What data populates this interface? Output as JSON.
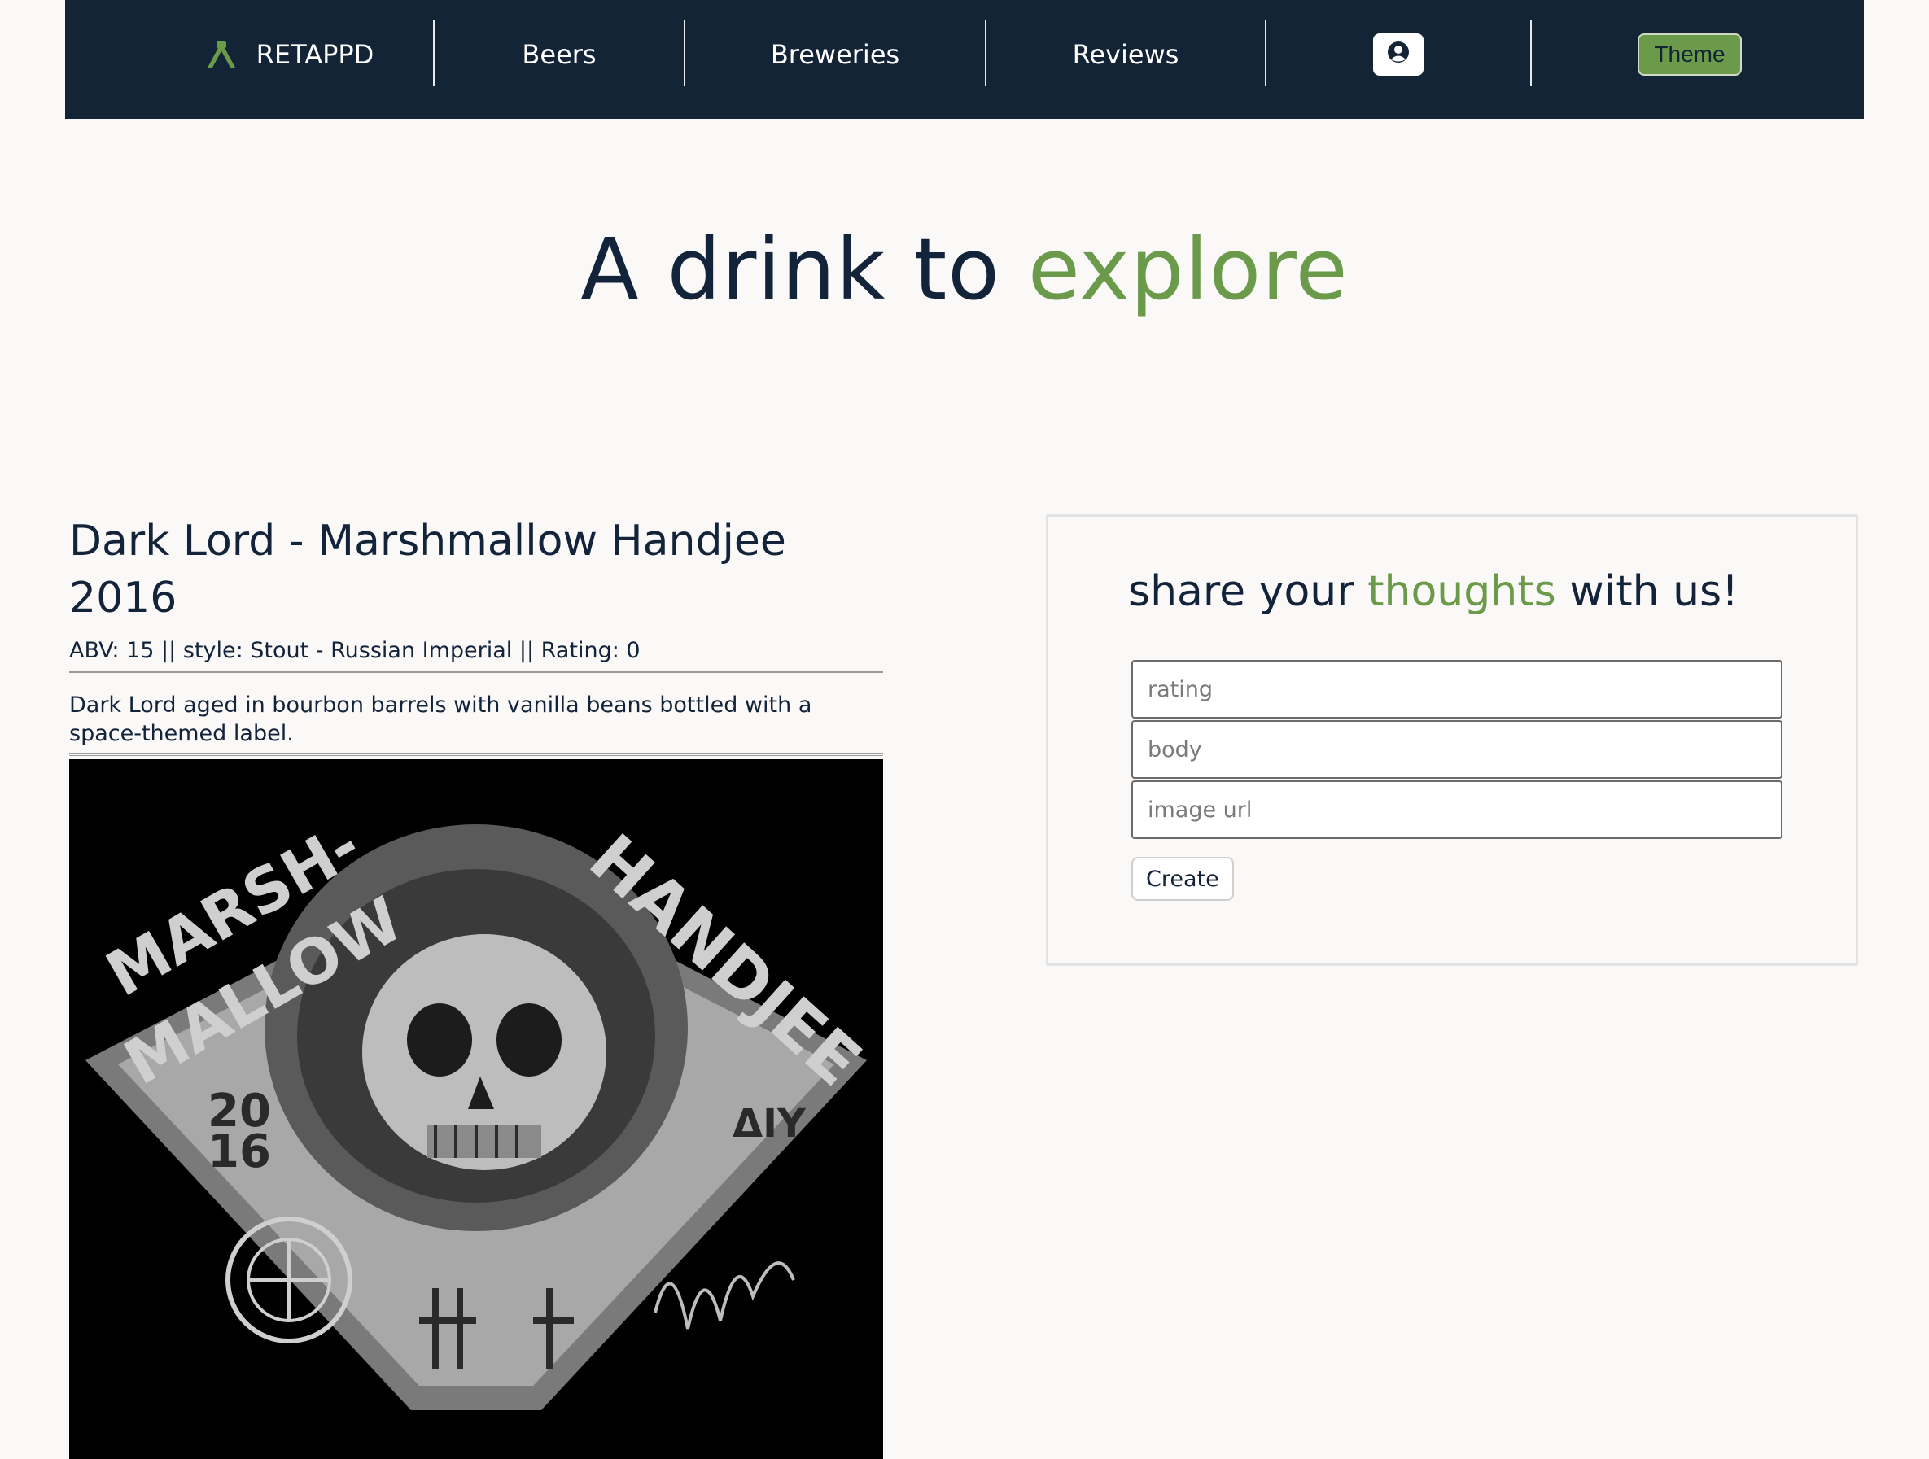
{
  "nav": {
    "brand": "RETAPPD",
    "items": [
      {
        "label": "Beers"
      },
      {
        "label": "Breweries"
      },
      {
        "label": "Reviews"
      }
    ],
    "user_icon": "user-circle-icon",
    "theme_label": "Theme"
  },
  "hero": {
    "prefix": "A drink to",
    "accent": "explore"
  },
  "beer": {
    "title": "Dark Lord - Marshmallow Handjee 2016",
    "meta": "ABV: 15 || style: Stout - Russian Imperial || Rating: 0",
    "description": "Dark Lord aged in bourbon barrels with vanilla beans bottled with a space-themed label.",
    "image": {
      "text_marsh": "MARSH-",
      "text_mallow": "MALLOW",
      "text_handjee": "HANDJEE",
      "text_year_top": "20",
      "text_year_bottom": "16",
      "text_right": "ΔIY"
    }
  },
  "review": {
    "heading_prefix": "share your",
    "heading_accent": "thoughts",
    "heading_suffix": "with us!",
    "rating_placeholder": "rating",
    "body_placeholder": "body",
    "image_url_placeholder": "image url",
    "create_label": "Create"
  },
  "colors": {
    "nav_bg": "#132437",
    "accent": "#6a9a4a",
    "page_bg": "#faf9f8",
    "text": "#12233a"
  }
}
